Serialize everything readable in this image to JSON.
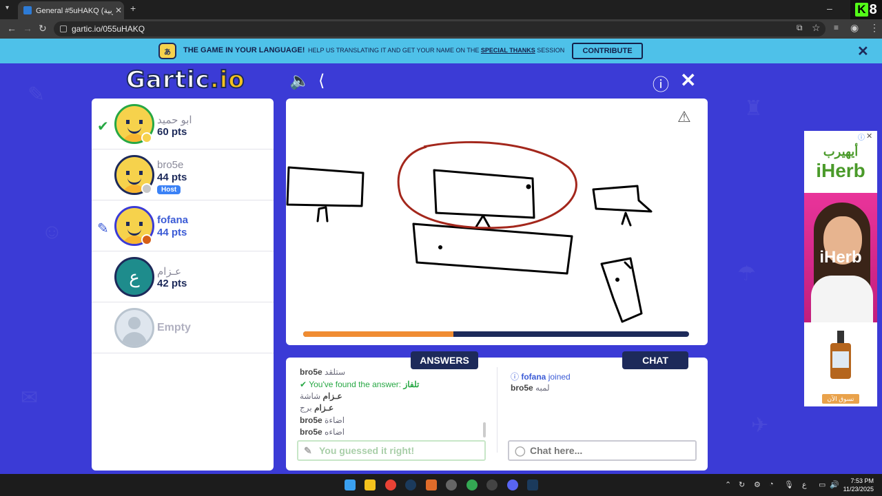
{
  "browser": {
    "tab_title": "General #5uHAKQ (العربية) - Ga",
    "url": "gartic.io/055uHAKQ",
    "badge_number": "8",
    "badge_letter": "K"
  },
  "banner": {
    "title": "THE GAME IN YOUR LANGUAGE!",
    "text_before": "HELP US TRANSLATING IT AND GET YOUR NAME ON THE ",
    "link": "SPECIAL THANKS",
    "text_after": " SESSION",
    "button": "CONTRIBUTE",
    "icon_text": "あ"
  },
  "header": {
    "logo_main": "Gartic",
    "logo_suffix": ".io"
  },
  "players": [
    {
      "name": "ابو حميد",
      "pts": "60 pts",
      "status_color": "#f6d24c",
      "mark": "check"
    },
    {
      "name": "bro5e",
      "pts": "44 pts",
      "status_color": "#c7c7c7",
      "badge": "Host"
    },
    {
      "name": "fofana",
      "pts": "44 pts",
      "status_color": "#d65f17",
      "mark": "pencil"
    },
    {
      "name": "عـزام",
      "pts": "42 pts",
      "avatar_letter": "ع"
    },
    {
      "name": "Empty"
    }
  ],
  "round": {
    "time_remaining_fraction": 0.39
  },
  "answers": {
    "tab": "ANSWERS",
    "messages": [
      {
        "user": "bro5e",
        "text": "ستلقد"
      },
      {
        "found_prefix": "You've found the answer:",
        "found_word": "تلفاز"
      },
      {
        "user": "عـزام",
        "text": "شاشة"
      },
      {
        "user": "عـزام",
        "text": "برج"
      },
      {
        "user": "bro5e",
        "text": "اضاءة"
      },
      {
        "user": "bro5e",
        "text": "اضاءه"
      }
    ],
    "input_placeholder": "You guessed it right!"
  },
  "chat": {
    "tab": "CHAT",
    "joined_user": "fofana",
    "joined_text": "joined",
    "message_user": "bro5e",
    "message_text": "لمبه",
    "input_placeholder": "Chat here..."
  },
  "ad": {
    "arabic": "أيهيرب",
    "brand": "iHerb",
    "photo_text": "iHerb",
    "cta": "تسوق الآن"
  },
  "taskbar": {
    "time": "7:53 PM",
    "date": "11/23/2025",
    "lang": "ع"
  }
}
